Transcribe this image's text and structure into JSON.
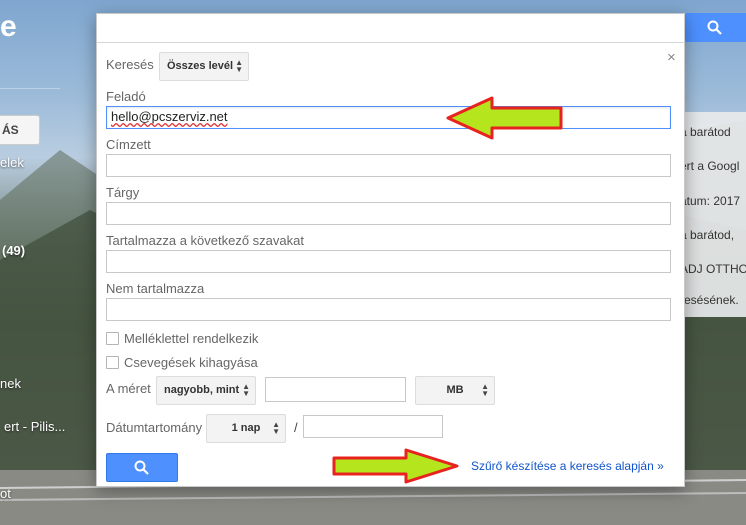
{
  "background": {
    "logo_fragment": "e",
    "left_button": "ÁS",
    "left_items": [
      "elek",
      "(49)",
      "nek",
      "ert - Pilis...",
      "ot"
    ],
    "right_items": [
      "a barátod",
      "ert a Googl",
      "átum: 2017",
      "a barátod,",
      "ADJ OTTHO",
      "resésének."
    ]
  },
  "dialog": {
    "search_label": "Keresés",
    "search_scope": "Összes levél",
    "from_label": "Feladó",
    "from_value": "hello@pcszerviz.net",
    "to_label": "Címzett",
    "to_value": "",
    "subject_label": "Tárgy",
    "subject_value": "",
    "has_words_label": "Tartalmazza a következő szavakat",
    "has_words_value": "",
    "not_has_label": "Nem tartalmazza",
    "not_has_value": "",
    "has_attachment_label": "Melléklettel rendelkezik",
    "skip_chats_label": "Csevegések kihagyása",
    "size_label": "A méret",
    "size_operator": "nagyobb, mint",
    "size_value": "",
    "size_unit": "MB",
    "date_label": "Dátumtartomány",
    "date_range": "1 nap",
    "date_separator": "/",
    "date_value": "",
    "close_symbol": "×",
    "create_filter_link": "Szűrő készítése a keresés alapján »"
  },
  "colors": {
    "accent": "#4d90fe",
    "link": "#1155cc",
    "arrow_fill": "#b5e61d",
    "arrow_stroke": "#e8231f"
  },
  "icons": {
    "search_button_icon": "search-icon",
    "top_search_icon": "search-icon",
    "close_icon": "close-icon"
  }
}
